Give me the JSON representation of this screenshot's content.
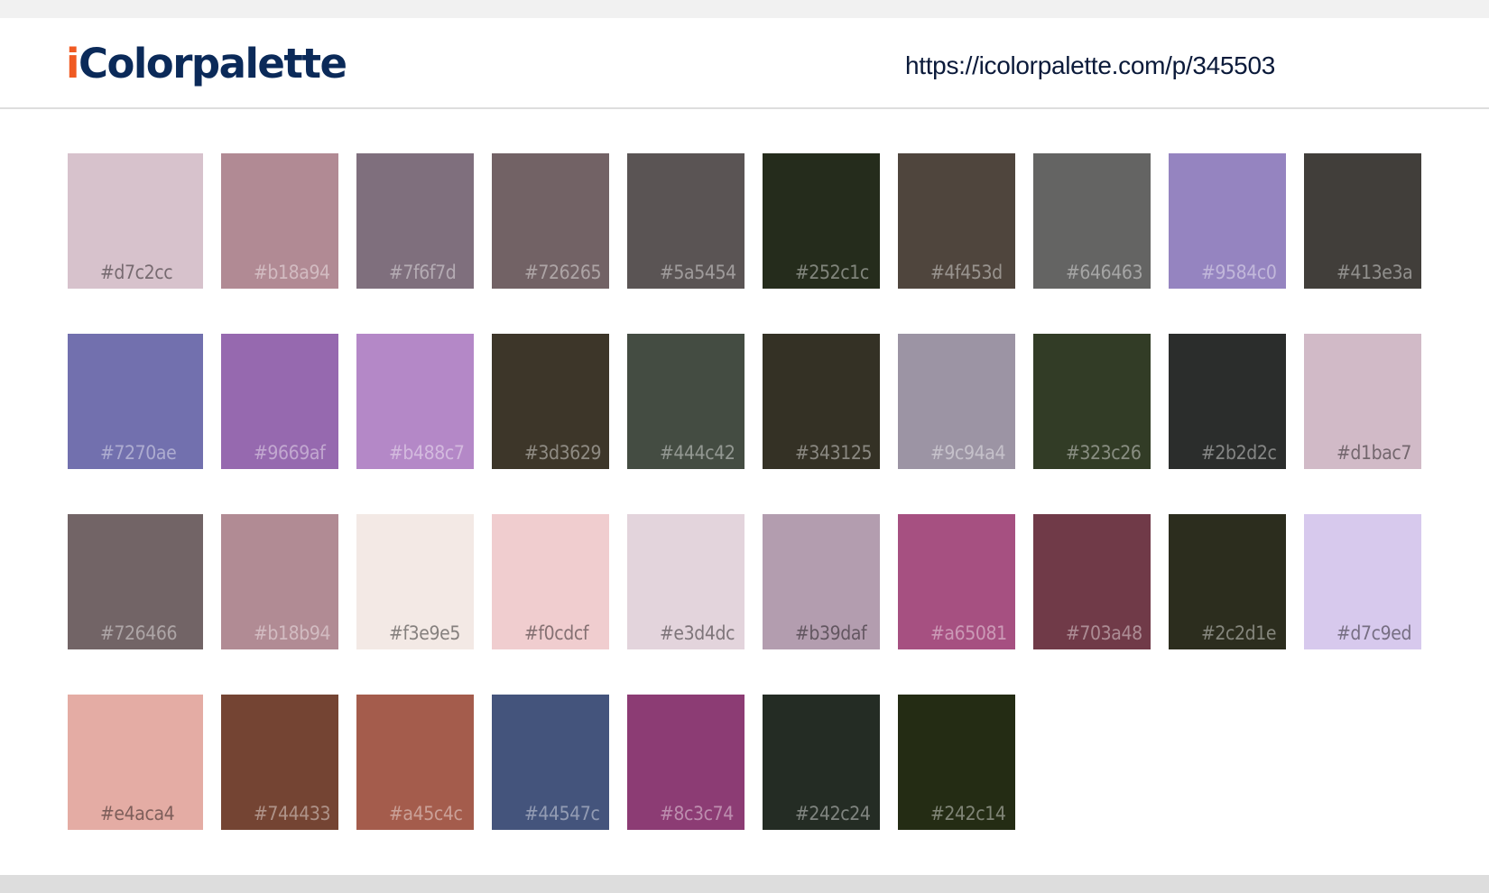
{
  "header": {
    "logo_initial": "i",
    "logo_rest": "Colorpalette",
    "url": "https://icolorpalette.com/p/345503"
  },
  "colors": {
    "logo_text": "#0b2a59",
    "logo_accent": "#f05a22",
    "background": "#ffffff"
  },
  "swatches": [
    {
      "hex": "#d7c2cc",
      "label": "#d7c2cc"
    },
    {
      "hex": "#b18a94",
      "label": "#b18a94"
    },
    {
      "hex": "#7f6f7d",
      "label": "#7f6f7d"
    },
    {
      "hex": "#726265",
      "label": "#726265"
    },
    {
      "hex": "#5a5454",
      "label": "#5a5454"
    },
    {
      "hex": "#252c1c",
      "label": "#252c1c"
    },
    {
      "hex": "#4f453d",
      "label": "#4f453d"
    },
    {
      "hex": "#646463",
      "label": "#646463"
    },
    {
      "hex": "#9584c0",
      "label": "#9584c0"
    },
    {
      "hex": "#413e3a",
      "label": "#413e3a"
    },
    {
      "hex": "#7270ae",
      "label": "#7270ae"
    },
    {
      "hex": "#9669af",
      "label": "#9669af"
    },
    {
      "hex": "#b488c7",
      "label": "#b488c7"
    },
    {
      "hex": "#3d3629",
      "label": "#3d3629"
    },
    {
      "hex": "#444c42",
      "label": "#444c42"
    },
    {
      "hex": "#343125",
      "label": "#343125"
    },
    {
      "hex": "#9c94a4",
      "label": "#9c94a4"
    },
    {
      "hex": "#323c26",
      "label": "#323c26"
    },
    {
      "hex": "#2b2d2c",
      "label": "#2b2d2c"
    },
    {
      "hex": "#d1bac7",
      "label": "#d1bac7"
    },
    {
      "hex": "#726466",
      "label": "#726466"
    },
    {
      "hex": "#b18b94",
      "label": "#b18b94"
    },
    {
      "hex": "#f3e9e5",
      "label": "#f3e9e5"
    },
    {
      "hex": "#f0cdcf",
      "label": "#f0cdcf"
    },
    {
      "hex": "#e3d4dc",
      "label": "#e3d4dc"
    },
    {
      "hex": "#b39daf",
      "label": "#b39daf"
    },
    {
      "hex": "#a65081",
      "label": "#a65081"
    },
    {
      "hex": "#703a48",
      "label": "#703a48"
    },
    {
      "hex": "#2c2d1e",
      "label": "#2c2d1e"
    },
    {
      "hex": "#d7c9ed",
      "label": "#d7c9ed"
    },
    {
      "hex": "#e4aca4",
      "label": "#e4aca4"
    },
    {
      "hex": "#744433",
      "label": "#744433"
    },
    {
      "hex": "#a45c4c",
      "label": "#a45c4c"
    },
    {
      "hex": "#44547c",
      "label": "#44547c"
    },
    {
      "hex": "#8c3c74",
      "label": "#8c3c74"
    },
    {
      "hex": "#242c24",
      "label": "#242c24"
    },
    {
      "hex": "#242c14",
      "label": "#242c14"
    }
  ]
}
